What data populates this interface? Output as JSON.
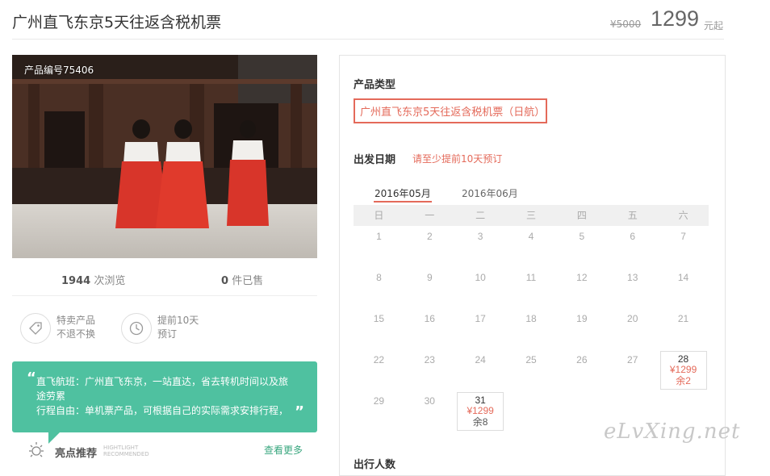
{
  "header": {
    "title": "广州直飞东京5天往返含税机票",
    "original_price": "¥5000",
    "price": "1299",
    "price_unit": "元起"
  },
  "photo": {
    "product_number": "产品编号75406"
  },
  "stats": {
    "views_count": "1944",
    "views_label": "次浏览",
    "sold_count": "0",
    "sold_label": "件已售"
  },
  "badges": [
    {
      "line1": "特卖产品",
      "line2": "不退不换",
      "icon": "tag-icon"
    },
    {
      "line1": "提前10天",
      "line2": "预订",
      "icon": "clock-icon"
    }
  ],
  "feature": {
    "line1": "直飞航班：广州直飞东京，一站直达，省去转机时间以及旅",
    "line2": "途劳累",
    "line3": "行程自由：单机票产品，可根据自己的实际需求安排行程，"
  },
  "recommend": {
    "label": "亮点推荐",
    "en_line1": "HIGHTLIGHT",
    "en_line2": "RECOMMENDED",
    "more": "查看更多",
    "icon": "sun-icon"
  },
  "panel": {
    "product_type_title": "产品类型",
    "product_type_option": "广州直飞东京5天往返含税机票（日航）",
    "departure_title": "出发日期",
    "departure_note": "请至少提前10天预订",
    "month_tabs": [
      "2016年05月",
      "2016年06月"
    ],
    "weekdays": [
      "日",
      "一",
      "二",
      "三",
      "四",
      "五",
      "六"
    ],
    "days": [
      {
        "n": "1",
        "col": 1,
        "row": 0
      },
      {
        "n": "2",
        "col": 2,
        "row": 0
      },
      {
        "n": "3",
        "col": 3,
        "row": 0
      },
      {
        "n": "4",
        "col": 4,
        "row": 0
      },
      {
        "n": "5",
        "col": 5,
        "row": 0
      },
      {
        "n": "6",
        "col": 6,
        "row": 0
      },
      {
        "n": "7",
        "col": 7,
        "row": 0
      },
      {
        "n": "8",
        "col": 1,
        "row": 1
      },
      {
        "n": "9",
        "col": 2,
        "row": 1
      },
      {
        "n": "10",
        "col": 3,
        "row": 1
      },
      {
        "n": "11",
        "col": 4,
        "row": 1
      },
      {
        "n": "12",
        "col": 5,
        "row": 1
      },
      {
        "n": "13",
        "col": 6,
        "row": 1
      },
      {
        "n": "14",
        "col": 7,
        "row": 1
      },
      {
        "n": "15",
        "col": 1,
        "row": 2
      },
      {
        "n": "16",
        "col": 2,
        "row": 2
      },
      {
        "n": "17",
        "col": 3,
        "row": 2
      },
      {
        "n": "18",
        "col": 4,
        "row": 2
      },
      {
        "n": "19",
        "col": 5,
        "row": 2
      },
      {
        "n": "20",
        "col": 6,
        "row": 2
      },
      {
        "n": "21",
        "col": 7,
        "row": 2
      },
      {
        "n": "22",
        "col": 1,
        "row": 3
      },
      {
        "n": "23",
        "col": 2,
        "row": 3
      },
      {
        "n": "24",
        "col": 3,
        "row": 3
      },
      {
        "n": "25",
        "col": 4,
        "row": 3
      },
      {
        "n": "26",
        "col": 5,
        "row": 3
      },
      {
        "n": "27",
        "col": 6,
        "row": 3
      },
      {
        "n": "28",
        "col": 7,
        "row": 3,
        "price": "¥1299",
        "left": "余2"
      },
      {
        "n": "29",
        "col": 1,
        "row": 4
      },
      {
        "n": "30",
        "col": 2,
        "row": 4
      },
      {
        "n": "31",
        "col": 3,
        "row": 4,
        "price": "¥1299",
        "left": "余8"
      }
    ],
    "next_section_title": "出行人数"
  },
  "watermark": "eLvXing.net",
  "colors": {
    "accent": "#e46a5a",
    "teal": "#4fc1a0",
    "link_green": "#3aa77f"
  }
}
